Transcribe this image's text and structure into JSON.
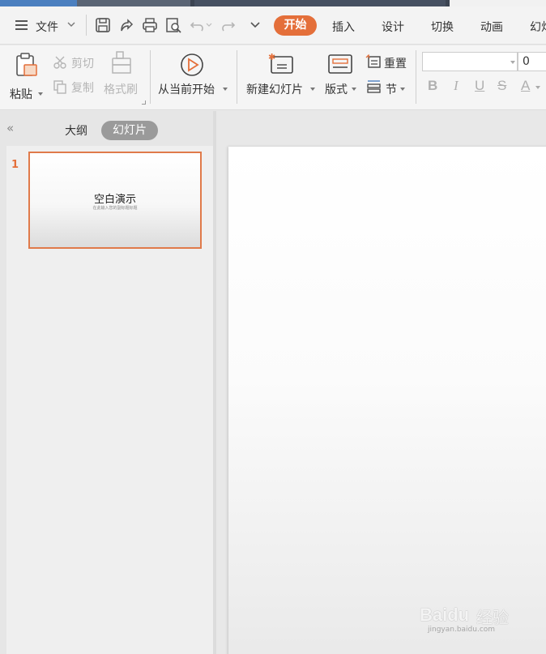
{
  "menu": {
    "file_label": "文件",
    "tabs": [
      "开始",
      "插入",
      "设计",
      "切换",
      "动画",
      "幻灯"
    ],
    "active_tab": "开始"
  },
  "ribbon": {
    "paste": "粘贴",
    "cut": "剪切",
    "copy": "复制",
    "format_painter": "格式刷",
    "play_from_current": "从当前开始",
    "new_slide": "新建幻灯片",
    "layout": "版式",
    "reset": "重置",
    "section": "节",
    "font_name_value": "",
    "font_size_value": "0",
    "format_buttons": [
      "B",
      "I",
      "U",
      "S",
      "A"
    ]
  },
  "left_panel": {
    "tab_outline": "大纲",
    "tab_slides": "幻灯片",
    "slides": [
      {
        "number": "1",
        "title": "空白演示",
        "subtitle": "在此输入您的副标题标题"
      }
    ]
  },
  "watermark": {
    "brand": "Baidu",
    "brand_cn": "经验",
    "url": "jingyan.baidu.com"
  },
  "colors": {
    "accent": "#e46f3a",
    "selection_border": "#e07a4a"
  }
}
